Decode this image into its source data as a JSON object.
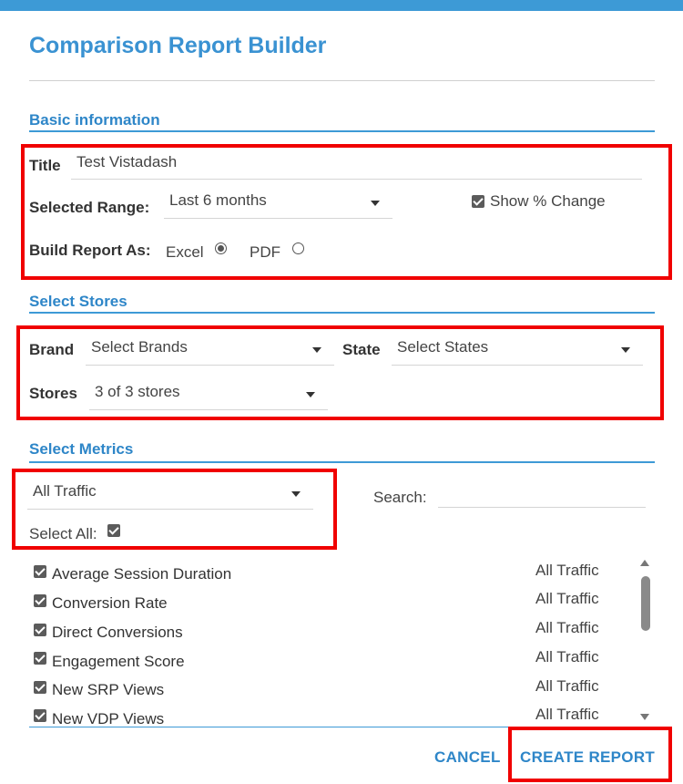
{
  "dialog": {
    "title": "Comparison Report Builder"
  },
  "basic": {
    "heading": "Basic information",
    "title_label": "Title",
    "title_value": "Test Vistadash",
    "range_label": "Selected Range:",
    "range_value": "Last 6 months",
    "show_change_label": "Show % Change",
    "build_label": "Build Report As:",
    "excel_label": "Excel",
    "pdf_label": "PDF"
  },
  "stores": {
    "heading": "Select Stores",
    "brand_label": "Brand",
    "brand_value": "Select Brands",
    "state_label": "State",
    "state_value": "Select States",
    "stores_label": "Stores",
    "stores_value": "3 of 3 stores"
  },
  "metrics": {
    "heading": "Select Metrics",
    "category_value": "All Traffic",
    "select_all_label": "Select All:",
    "search_label": "Search:",
    "items": [
      {
        "name": "Average Session Duration",
        "category": "All Traffic"
      },
      {
        "name": "Conversion Rate",
        "category": "All Traffic"
      },
      {
        "name": "Direct Conversions",
        "category": "All Traffic"
      },
      {
        "name": "Engagement Score",
        "category": "All Traffic"
      },
      {
        "name": "New SRP Views",
        "category": "All Traffic"
      },
      {
        "name": "New VDP Views",
        "category": "All Traffic"
      }
    ]
  },
  "actions": {
    "cancel": "CANCEL",
    "create": "CREATE REPORT"
  },
  "colors": {
    "accent": "#3d9ad6",
    "highlight": "#f00000"
  }
}
